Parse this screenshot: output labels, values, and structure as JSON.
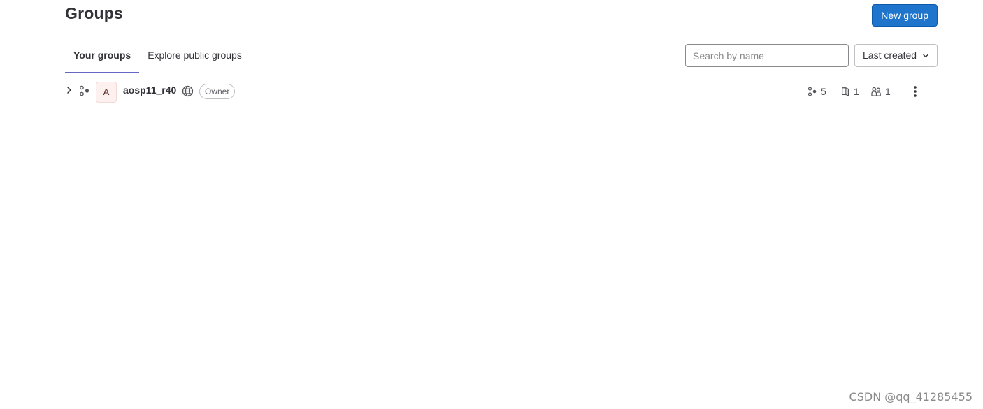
{
  "header": {
    "title": "Groups",
    "new_group_label": "New group"
  },
  "tabs": [
    {
      "label": "Your groups",
      "active": true
    },
    {
      "label": "Explore public groups",
      "active": false
    }
  ],
  "search": {
    "placeholder": "Search by name",
    "value": ""
  },
  "sort": {
    "selected": "Last created"
  },
  "groups": [
    {
      "avatar_letter": "A",
      "name": "aosp11_r40",
      "visibility_icon": "globe-icon",
      "role": "Owner",
      "subgroups_count": "5",
      "projects_count": "1",
      "members_count": "1"
    }
  ],
  "watermark": "CSDN @qq_41285455",
  "colors": {
    "accent": "#1f75cb",
    "tab_indicator": "#6666c4",
    "avatar_bg": "#fcf1ef"
  }
}
